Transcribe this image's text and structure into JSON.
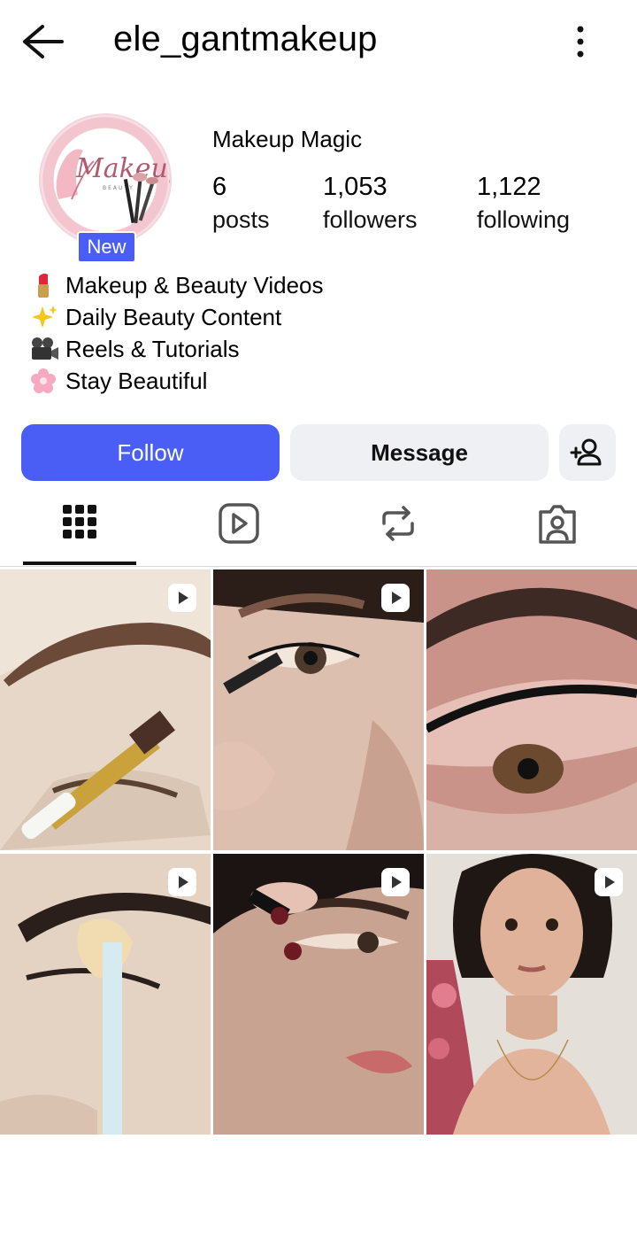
{
  "header": {
    "username": "ele_gantmakeup"
  },
  "profile": {
    "display_name": "Makeup Magic",
    "badge": "New",
    "avatar_logo_text": "Makeup",
    "stats": [
      {
        "value": "6",
        "label": "posts"
      },
      {
        "value": "1,053",
        "label": "followers"
      },
      {
        "value": "1,122",
        "label": "following"
      }
    ],
    "bio": [
      {
        "emoji": "lipstick",
        "text": "Makeup & Beauty Videos"
      },
      {
        "emoji": "sparkles",
        "text": "Daily Beauty Content"
      },
      {
        "emoji": "movie-camera",
        "text": "Reels & Tutorials"
      },
      {
        "emoji": "cherry-blossom",
        "text": "Stay Beautiful"
      }
    ]
  },
  "actions": {
    "follow_label": "Follow",
    "message_label": "Message"
  },
  "tabs": [
    "grid",
    "reels",
    "reposts",
    "tagged"
  ],
  "colors": {
    "accent": "#4a5ef5",
    "secondary_button": "#eff0f4"
  },
  "posts": [
    {
      "type": "reel",
      "subject": "eyebrow brush"
    },
    {
      "type": "reel",
      "subject": "eyeliner"
    },
    {
      "type": "reel",
      "subject": "pink eyeshadow"
    },
    {
      "type": "reel",
      "subject": "concealer"
    },
    {
      "type": "reel",
      "subject": "mascara"
    },
    {
      "type": "reel",
      "subject": "portrait"
    }
  ]
}
